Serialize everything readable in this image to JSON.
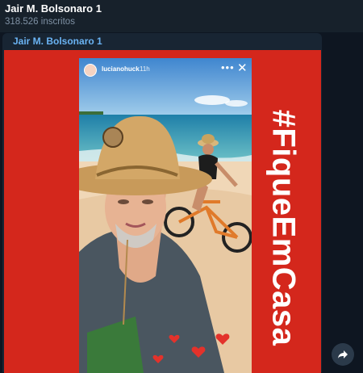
{
  "channel": {
    "title": "Jair M. Bolsonaro 1",
    "subscribers": "318.526 inscritos"
  },
  "message": {
    "sender": "Jair M. Bolsonaro 1"
  },
  "story": {
    "username": "lucianohuck",
    "time": "11h",
    "hashtag": "#FiqueEmCasa"
  },
  "colors": {
    "header_bg": "#17212b",
    "chat_bg": "#0e1621",
    "bubble_bg": "#182533",
    "sender_name": "#6ab3f3",
    "post_red": "#d4271c"
  },
  "icons": {
    "story_more": "more-horizontal-icon",
    "story_close": "close-icon",
    "forward": "forward-arrow-icon"
  }
}
